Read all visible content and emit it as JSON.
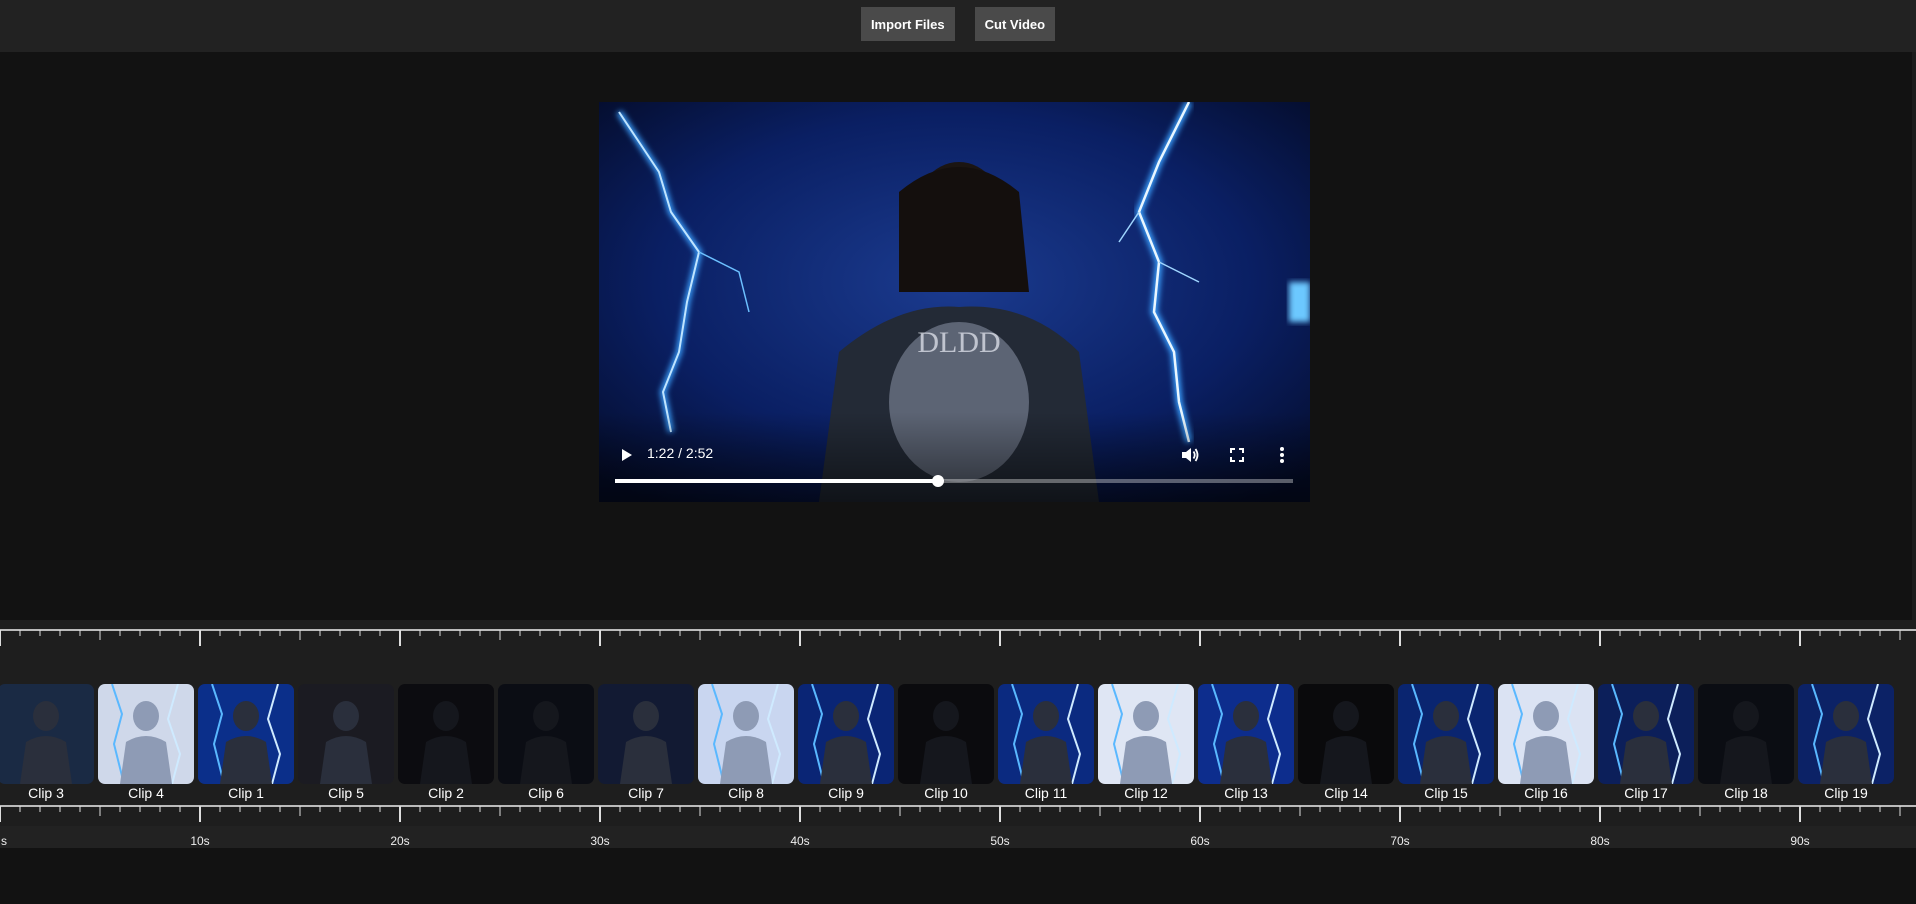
{
  "toolbar": {
    "import_label": "Import Files",
    "cut_label": "Cut Video"
  },
  "player": {
    "time_text": "1:22 / 2:52",
    "progress": 0.477,
    "state": "paused",
    "icons": {
      "play": "play-icon",
      "volume": "volume-icon",
      "fullscreen": "fullscreen-icon",
      "more": "more-options-icon"
    },
    "colors": {
      "background": "#05123a",
      "lightning": "#3aa0ff"
    }
  },
  "timeline": {
    "clips": [
      {
        "label": "Clip 3",
        "tone": "dark",
        "color": "#1a2a44"
      },
      {
        "label": "Clip 4",
        "tone": "bright",
        "color": "#cfd8ea"
      },
      {
        "label": "Clip 1",
        "tone": "blue",
        "color": "#0b2f8a"
      },
      {
        "label": "Clip 5",
        "tone": "dark",
        "color": "#1b1b22"
      },
      {
        "label": "Clip 2",
        "tone": "black",
        "color": "#0c0c10"
      },
      {
        "label": "Clip 6",
        "tone": "black",
        "color": "#0b0d14"
      },
      {
        "label": "Clip 7",
        "tone": "dark",
        "color": "#121a33"
      },
      {
        "label": "Clip 8",
        "tone": "bright",
        "color": "#c9d6f0"
      },
      {
        "label": "Clip 9",
        "tone": "blue",
        "color": "#0a2575"
      },
      {
        "label": "Clip 10",
        "tone": "black",
        "color": "#0b0b0e"
      },
      {
        "label": "Clip 11",
        "tone": "blue",
        "color": "#0b2a80"
      },
      {
        "label": "Clip 12",
        "tone": "bright",
        "color": "#dfe6f4"
      },
      {
        "label": "Clip 13",
        "tone": "blue",
        "color": "#0d2d8d"
      },
      {
        "label": "Clip 14",
        "tone": "black",
        "color": "#0a0a0c"
      },
      {
        "label": "Clip 15",
        "tone": "blue",
        "color": "#0a2570"
      },
      {
        "label": "Clip 16",
        "tone": "bright",
        "color": "#dbe3f3"
      },
      {
        "label": "Clip 17",
        "tone": "blue",
        "color": "#0c1f5a"
      },
      {
        "label": "Clip 18",
        "tone": "black",
        "color": "#0b0d13"
      },
      {
        "label": "Clip 19",
        "tone": "blue",
        "color": "#0c2266"
      }
    ],
    "time_labels": [
      "s",
      "10s",
      "20s",
      "30s",
      "40s",
      "50s",
      "60s",
      "70s",
      "80s",
      "90s"
    ]
  }
}
